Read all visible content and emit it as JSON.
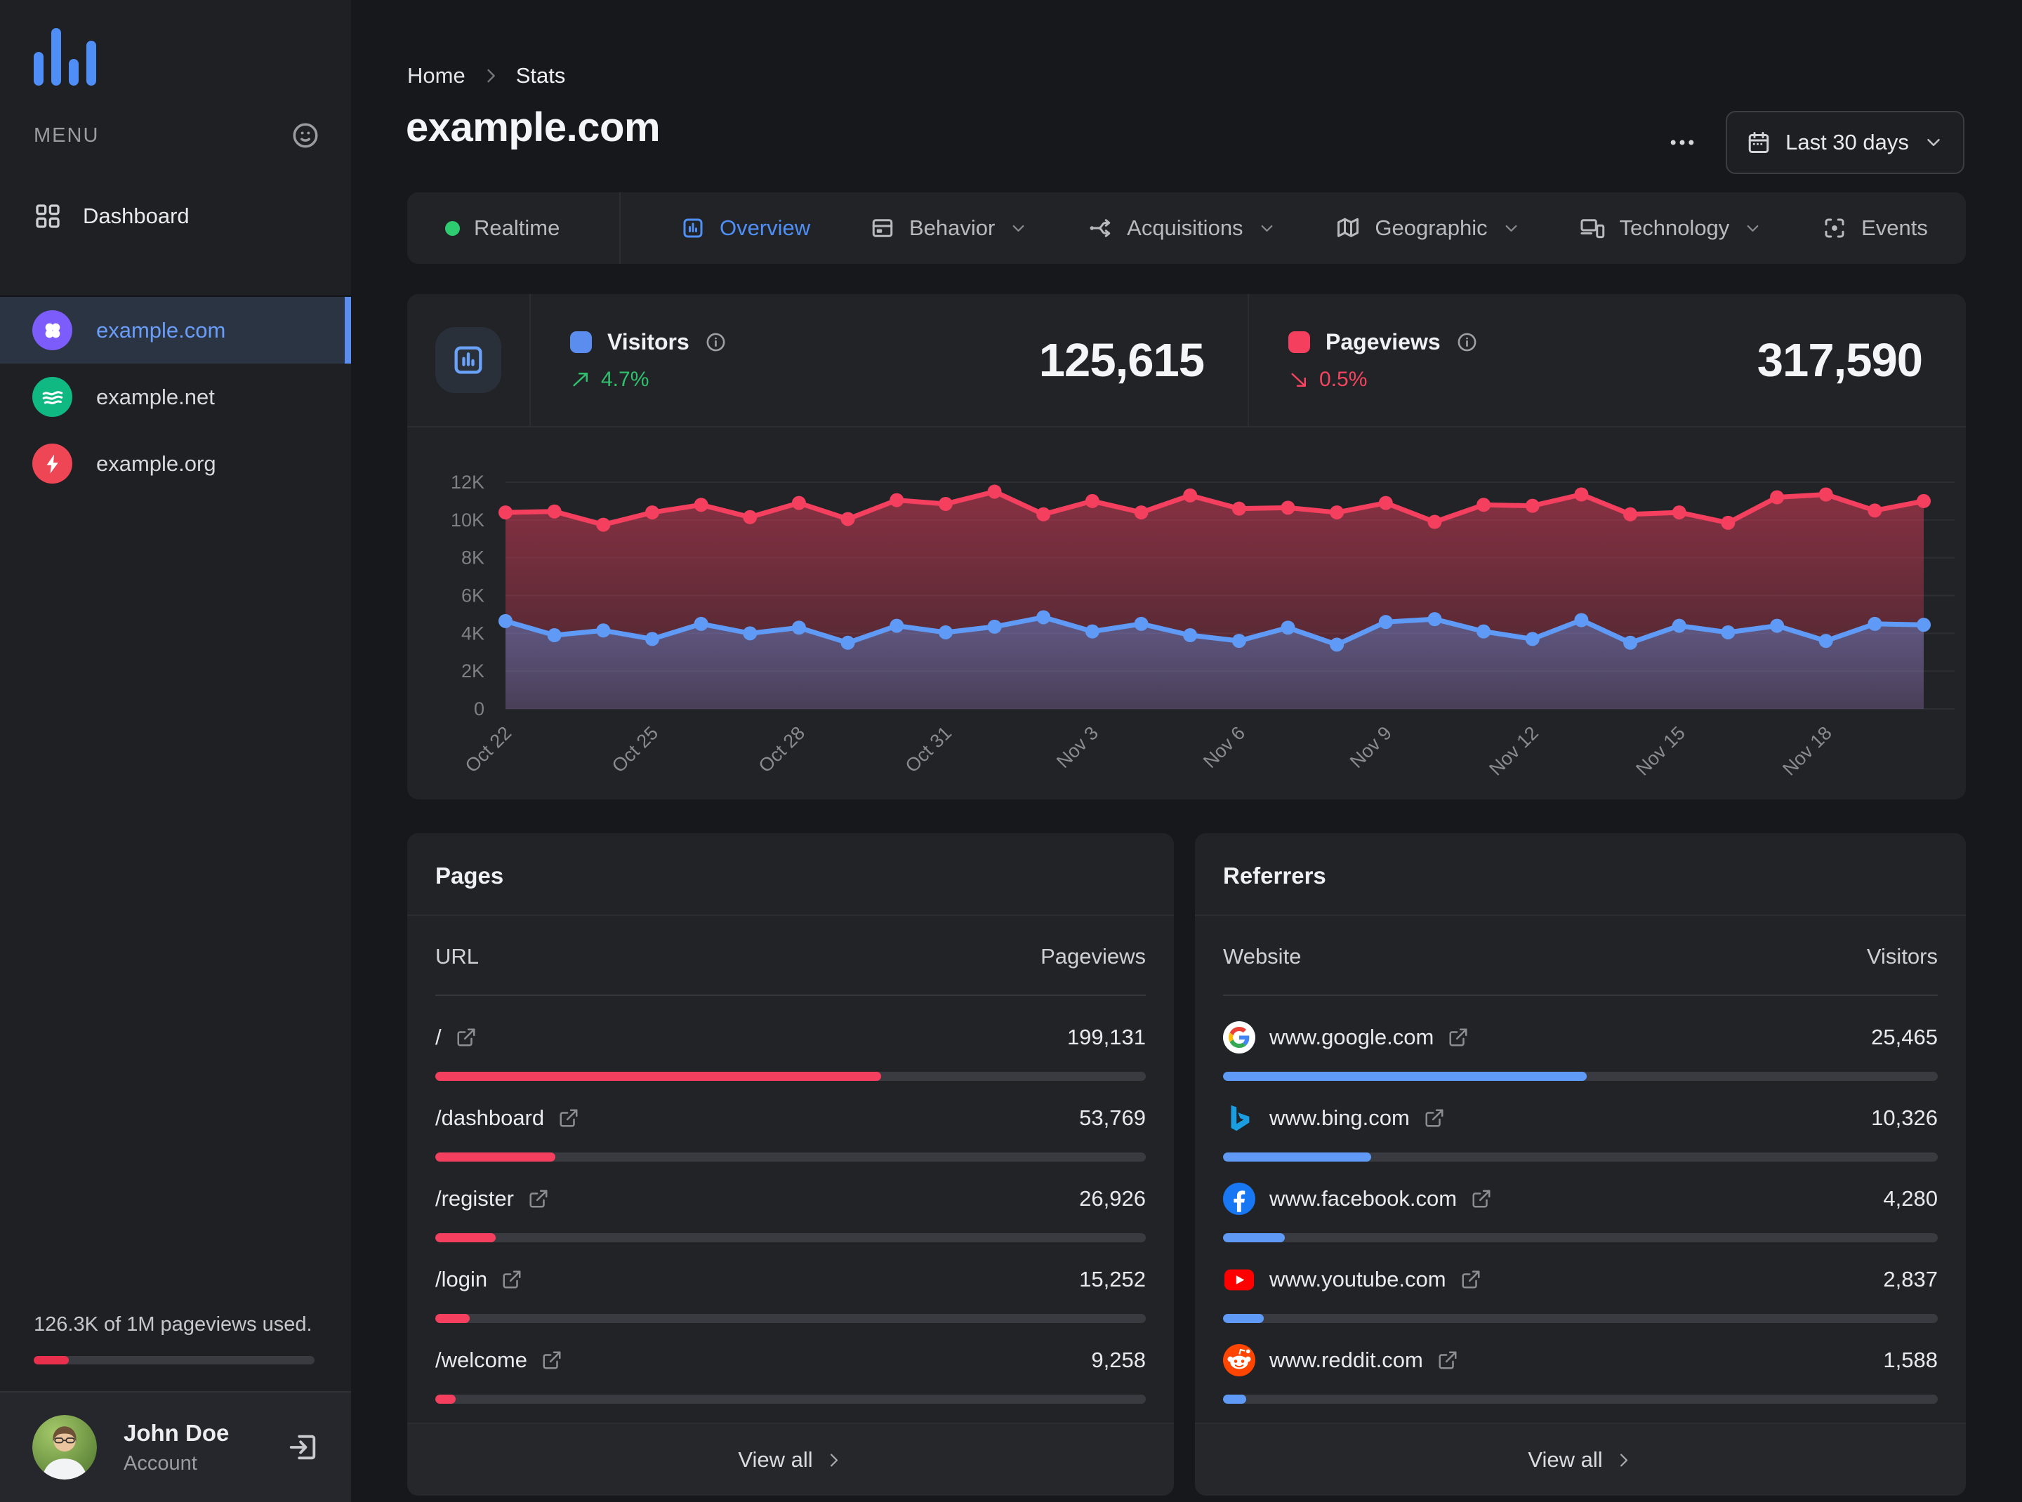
{
  "sidebar": {
    "menu_label": "MENU",
    "dashboard_label": "Dashboard",
    "sites": [
      {
        "name": "example.com",
        "icon": "clover",
        "color": "#7c5cfa",
        "active": true
      },
      {
        "name": "example.net",
        "icon": "waves",
        "color": "#10b981",
        "active": false
      },
      {
        "name": "example.org",
        "icon": "bolt",
        "color": "#ef4655",
        "active": false
      }
    ],
    "usage_text": "126.3K of 1M pageviews used.",
    "usage_pct": 12.6,
    "user": {
      "name": "John Doe",
      "role": "Account"
    }
  },
  "header": {
    "breadcrumb": {
      "home": "Home",
      "current": "Stats"
    },
    "title": "example.com",
    "date_range": "Last 30 days"
  },
  "tabs": [
    {
      "label": "Realtime",
      "icon": "dot",
      "caret": false,
      "active": false,
      "divider_after": true
    },
    {
      "label": "Overview",
      "icon": "overview",
      "caret": false,
      "active": true,
      "divider_after": false
    },
    {
      "label": "Behavior",
      "icon": "layout",
      "caret": true,
      "active": false,
      "divider_after": false
    },
    {
      "label": "Acquisitions",
      "icon": "split",
      "caret": true,
      "active": false,
      "divider_after": false
    },
    {
      "label": "Geographic",
      "icon": "map",
      "caret": true,
      "active": false,
      "divider_after": false
    },
    {
      "label": "Technology",
      "icon": "devices",
      "caret": true,
      "active": false,
      "divider_after": false
    },
    {
      "label": "Events",
      "icon": "focus",
      "caret": false,
      "active": false,
      "divider_after": false
    }
  ],
  "stats": [
    {
      "label": "Visitors",
      "color": "#5b8def",
      "value": "125,615",
      "delta": "4.7%",
      "trend": "up"
    },
    {
      "label": "Pageviews",
      "color": "#f43f5e",
      "value": "317,590",
      "delta": "0.5%",
      "trend": "down"
    }
  ],
  "chart_data": {
    "type": "line",
    "title": "Visitors and pageviews over last 30 days",
    "x_tick_labels": [
      "Oct 22",
      "Oct 25",
      "Oct 28",
      "Oct 31",
      "Nov 3",
      "Nov 6",
      "Nov 9",
      "Nov 12",
      "Nov 15",
      "Nov 18"
    ],
    "x_tick_indices": [
      0,
      3,
      6,
      9,
      12,
      15,
      18,
      21,
      24,
      27
    ],
    "y_tick_labels": [
      "0",
      "2K",
      "4K",
      "6K",
      "8K",
      "10K",
      "12K"
    ],
    "ylim": [
      0,
      12000
    ],
    "grid": "horizontal",
    "legend_position": "none",
    "series": [
      {
        "name": "Pageviews",
        "color": "#f43f5e",
        "values": [
          10400,
          10450,
          9750,
          10400,
          10800,
          10150,
          10900,
          10050,
          11050,
          10850,
          11500,
          10300,
          11000,
          10400,
          11300,
          10600,
          10650,
          10400,
          10900,
          9900,
          10800,
          10750,
          11350,
          10300,
          10400,
          9850,
          11200,
          11350,
          10500,
          11000
        ]
      },
      {
        "name": "Visitors",
        "color": "#5f9bf6",
        "values": [
          4650,
          3900,
          4150,
          3700,
          4500,
          4000,
          4300,
          3500,
          4400,
          4050,
          4350,
          4850,
          4100,
          4500,
          3900,
          3600,
          4300,
          3400,
          4600,
          4750,
          4100,
          3700,
          4700,
          3500,
          4400,
          4050,
          4400,
          3600,
          4500,
          4450
        ]
      }
    ]
  },
  "pages_panel": {
    "title": "Pages",
    "col_left": "URL",
    "col_right": "Pageviews",
    "bar_color": "#f43f5e",
    "view_all": "View all",
    "rows": [
      {
        "label": "/",
        "value": "199,131",
        "bar_pct": 62.7
      },
      {
        "label": "/dashboard",
        "value": "53,769",
        "bar_pct": 16.9
      },
      {
        "label": "/register",
        "value": "26,926",
        "bar_pct": 8.5
      },
      {
        "label": "/login",
        "value": "15,252",
        "bar_pct": 4.8
      },
      {
        "label": "/welcome",
        "value": "9,258",
        "bar_pct": 2.9
      }
    ]
  },
  "referrers_panel": {
    "title": "Referrers",
    "col_left": "Website",
    "col_right": "Visitors",
    "bar_color": "#5f9bf6",
    "view_all": "View all",
    "rows": [
      {
        "label": "www.google.com",
        "icon": "google",
        "value": "25,465",
        "bar_pct": 50.9
      },
      {
        "label": "www.bing.com",
        "icon": "bing",
        "value": "10,326",
        "bar_pct": 20.7
      },
      {
        "label": "www.facebook.com",
        "icon": "facebook",
        "value": "4,280",
        "bar_pct": 8.6
      },
      {
        "label": "www.youtube.com",
        "icon": "youtube",
        "value": "2,837",
        "bar_pct": 5.7
      },
      {
        "label": "www.reddit.com",
        "icon": "reddit",
        "value": "1,588",
        "bar_pct": 3.2
      }
    ]
  }
}
